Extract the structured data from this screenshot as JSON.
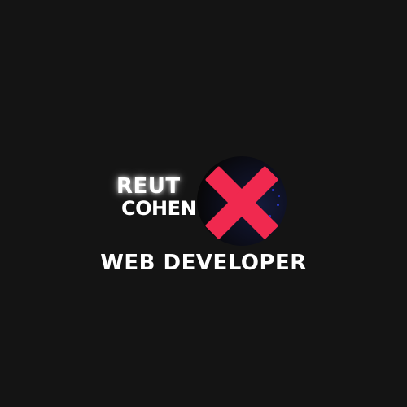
{
  "logo": {
    "first_name": "REUT",
    "last_name": "COHEN",
    "mark_icon": "x-mark-icon",
    "mark_color": "#f0294f",
    "circle_color": "#070707"
  },
  "tagline": "WEB DEVELOPER",
  "background_color": "#141414"
}
